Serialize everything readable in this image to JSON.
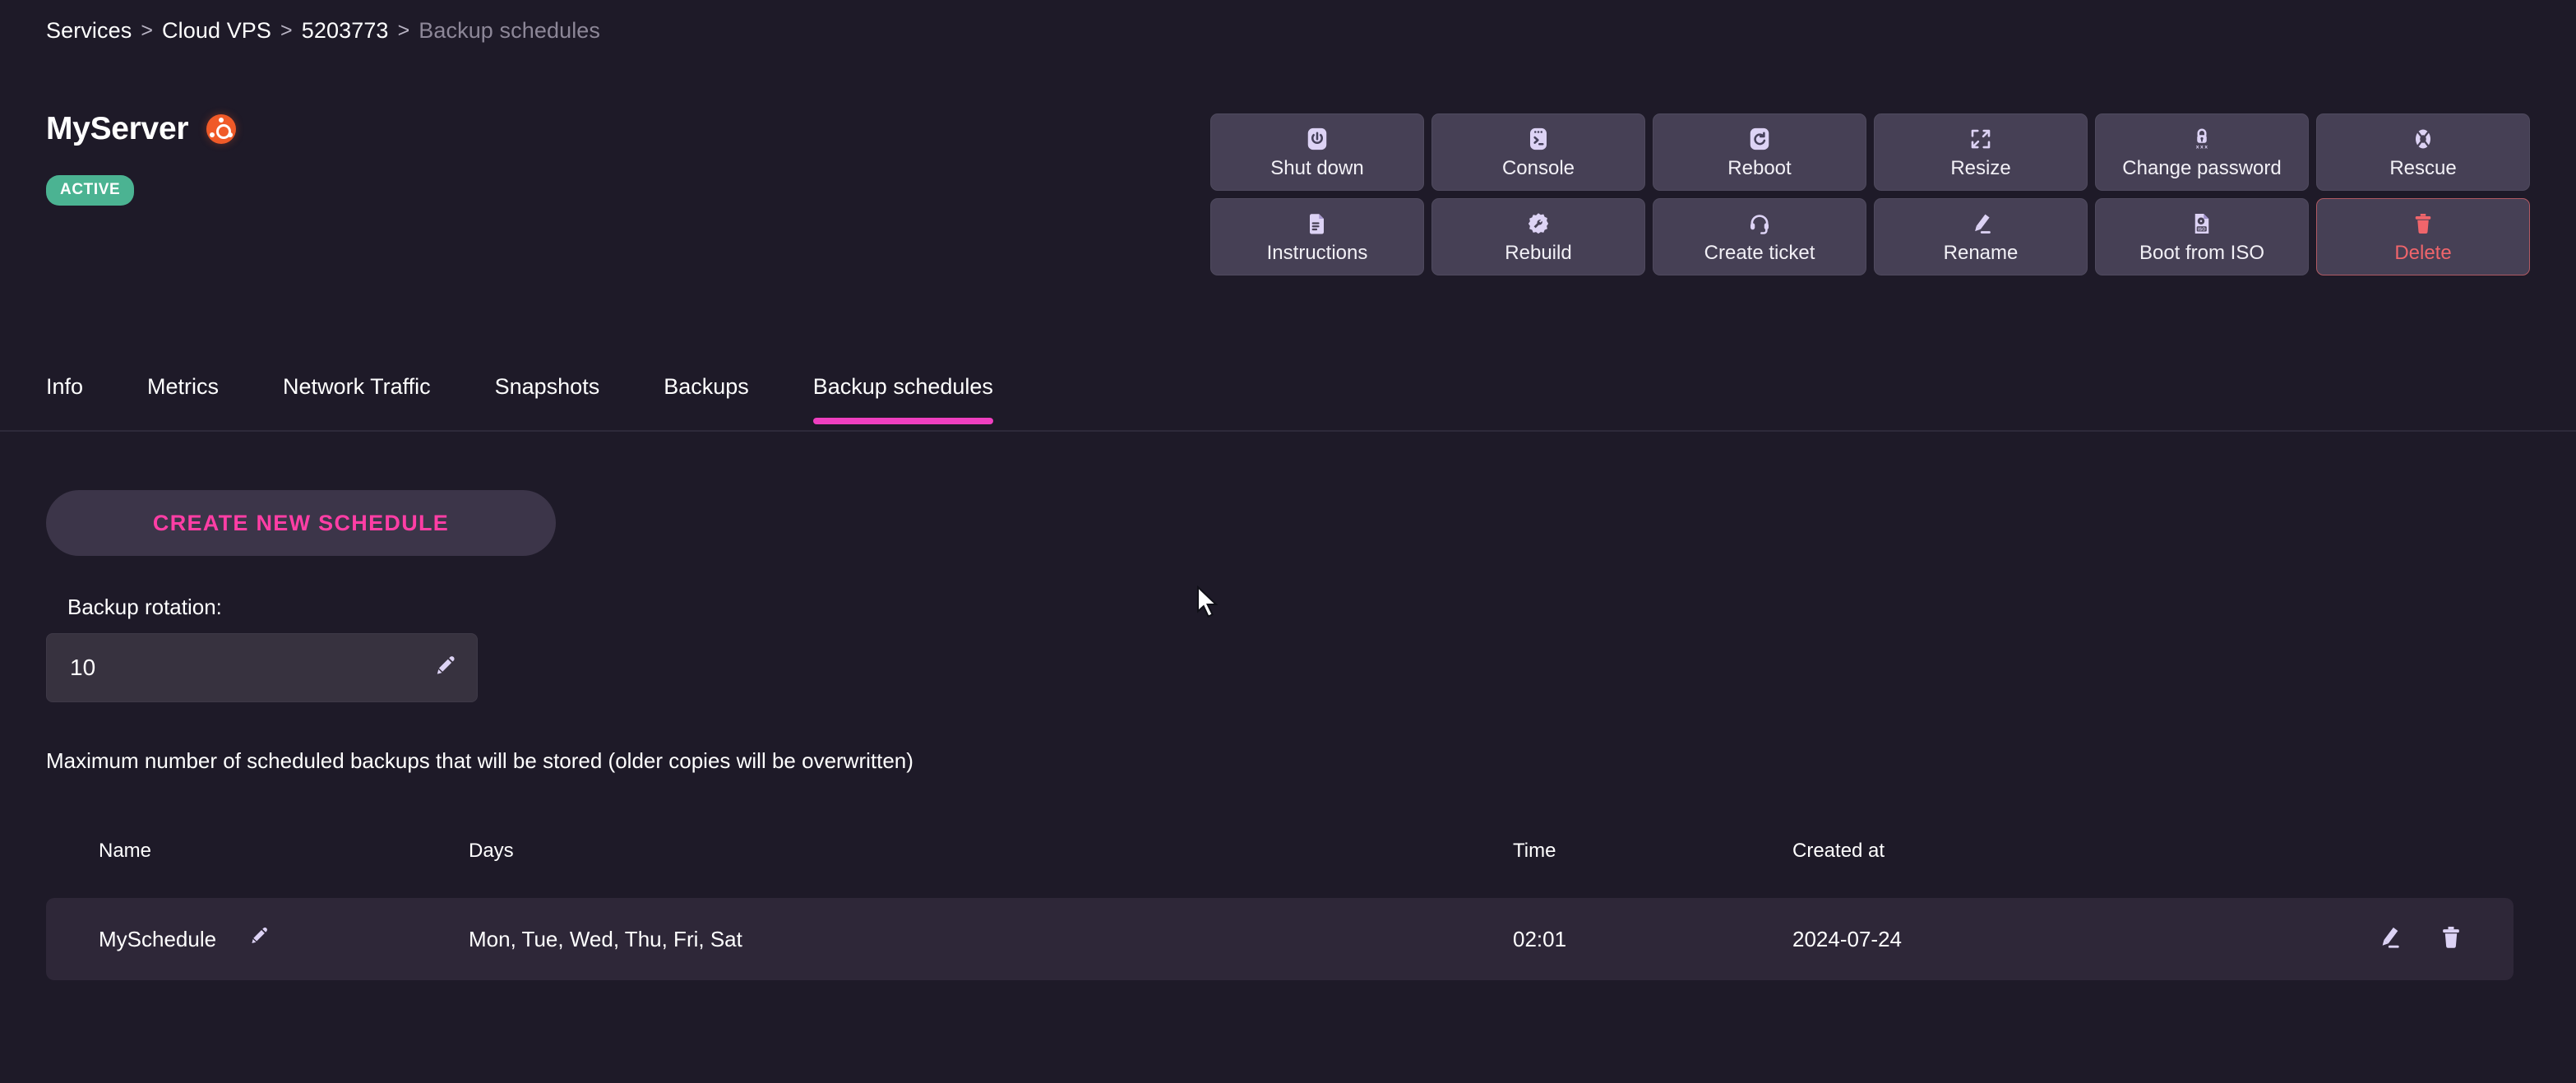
{
  "breadcrumb": {
    "separator": ">",
    "items": [
      {
        "label": "Services",
        "current": false
      },
      {
        "label": "Cloud VPS",
        "current": false
      },
      {
        "label": "5203773",
        "current": false
      },
      {
        "label": "Backup schedules",
        "current": true
      }
    ]
  },
  "header": {
    "server_name": "MyServer",
    "os_icon": "ubuntu-logo-icon",
    "status": "ACTIVE",
    "status_color": "#4bb392",
    "os_color": "#f05a28"
  },
  "actions": [
    {
      "label": "Shut down",
      "icon": "power-icon",
      "danger": false
    },
    {
      "label": "Console",
      "icon": "terminal-icon",
      "danger": false
    },
    {
      "label": "Reboot",
      "icon": "reboot-icon",
      "danger": false
    },
    {
      "label": "Resize",
      "icon": "expand-icon",
      "danger": false
    },
    {
      "label": "Change password",
      "icon": "lock-password-icon",
      "danger": false
    },
    {
      "label": "Rescue",
      "icon": "lifebuoy-icon",
      "danger": false
    },
    {
      "label": "Instructions",
      "icon": "document-icon",
      "danger": false
    },
    {
      "label": "Rebuild",
      "icon": "wrench-gear-icon",
      "danger": false
    },
    {
      "label": "Create ticket",
      "icon": "headset-icon",
      "danger": false
    },
    {
      "label": "Rename",
      "icon": "pencil-icon",
      "danger": false
    },
    {
      "label": "Boot from ISO",
      "icon": "iso-disc-icon",
      "danger": false
    },
    {
      "label": "Delete",
      "icon": "trash-icon",
      "danger": true
    }
  ],
  "tabs": [
    {
      "label": "Info",
      "active": false
    },
    {
      "label": "Metrics",
      "active": false
    },
    {
      "label": "Network Traffic",
      "active": false
    },
    {
      "label": "Snapshots",
      "active": false
    },
    {
      "label": "Backups",
      "active": false
    },
    {
      "label": "Backup schedules",
      "active": true
    }
  ],
  "tab_accent": "#ef3fc0",
  "main": {
    "create_button": "CREATE NEW SCHEDULE",
    "create_button_color": "#ff3ea5",
    "rotation_label": "Backup rotation:",
    "rotation_value": "10",
    "rotation_edit_icon": "pencil-icon",
    "help_text": "Maximum number of scheduled backups that will be stored (older copies will be overwritten)"
  },
  "table": {
    "columns": [
      "Name",
      "Days",
      "Time",
      "Created at"
    ],
    "rows": [
      {
        "name": "MySchedule",
        "name_edit_icon": "pencil-icon",
        "days": "Mon, Tue, Wed, Thu, Fri, Sat",
        "time": "02:01",
        "created_at": "2024-07-24",
        "edit_icon": "pencil-icon",
        "delete_icon": "trash-icon"
      }
    ]
  }
}
